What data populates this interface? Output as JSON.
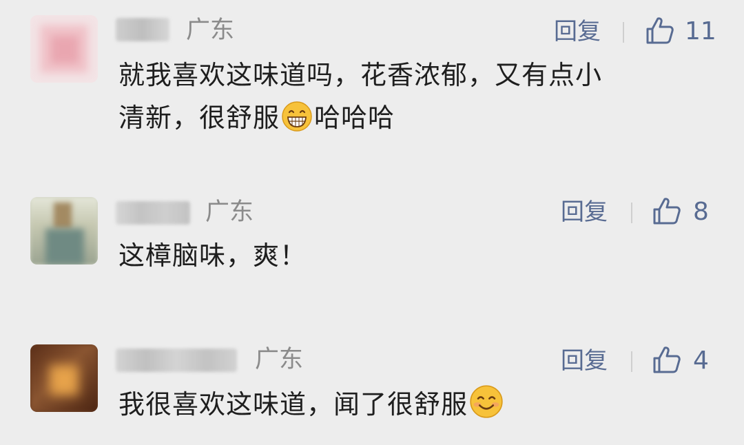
{
  "comments": [
    {
      "region": "广东",
      "reply_label": "回复",
      "like_count": "11",
      "text_line1": "就我喜欢这味道吗，花香浓郁，又有点小",
      "text_line2_a": "清新，很舒服",
      "text_line2_emoji": "grinning-face-emoji",
      "text_line2_b": "哈哈哈"
    },
    {
      "region": "广东",
      "reply_label": "回复",
      "like_count": "8",
      "text_line1": "这樟脑味，爽！"
    },
    {
      "region": "广东",
      "reply_label": "回复",
      "like_count": "4",
      "text_line1": "我很喜欢这味道，闻了很舒服",
      "text_line1_emoji": "smiling-face-emoji"
    }
  ],
  "colors": {
    "background": "#ededed",
    "link": "#586b92",
    "region": "#8b8b8b",
    "text": "#1e1e1e"
  }
}
